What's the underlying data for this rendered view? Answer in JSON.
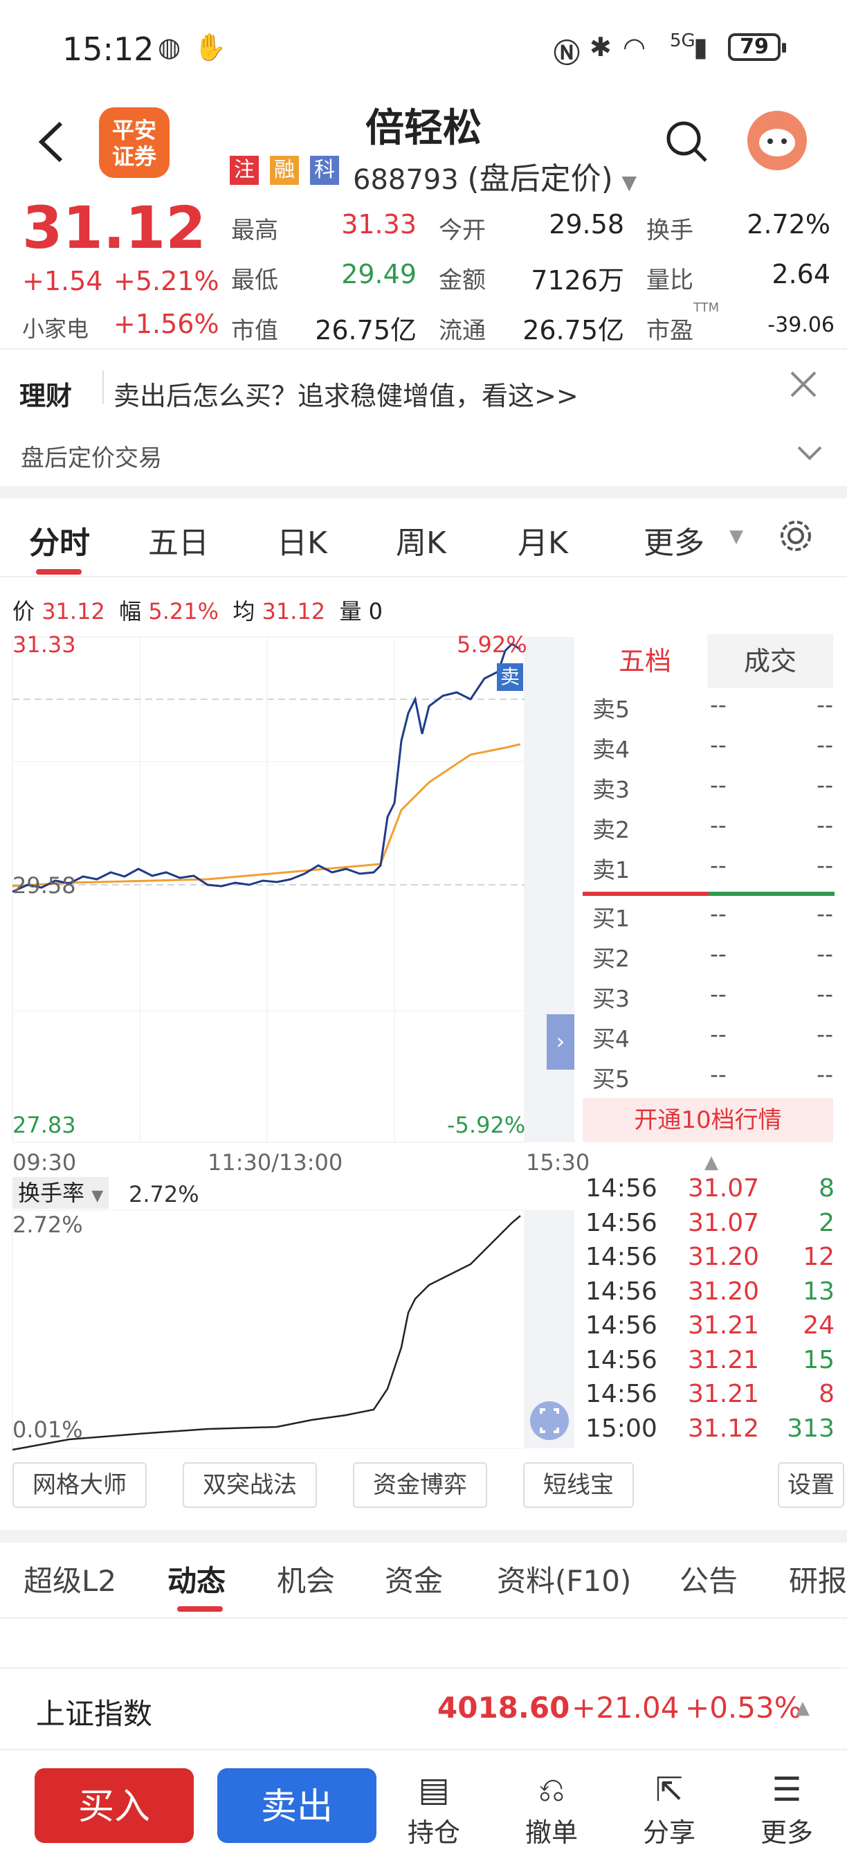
{
  "status": {
    "time": "15:12",
    "battery": "79",
    "net": "5G"
  },
  "header": {
    "logo_line1": "平安",
    "logo_line2": "证券",
    "stock_name": "倍轻松",
    "badges": [
      "注",
      "融",
      "科"
    ],
    "code": "688793",
    "mode": "(盘后定价)"
  },
  "quote": {
    "price": "31.12",
    "change": "+1.54",
    "change_pct": "+5.21%",
    "sector": "小家电",
    "sector_pct": "+1.56%",
    "stats": [
      {
        "label": "最高",
        "value": "31.33",
        "color": "red"
      },
      {
        "label": "今开",
        "value": "29.58",
        "color": "dark"
      },
      {
        "label": "换手",
        "value": "2.72%",
        "color": "dark"
      },
      {
        "label": "最低",
        "value": "29.49",
        "color": "green"
      },
      {
        "label": "金额",
        "value": "7126万",
        "color": "dark"
      },
      {
        "label": "量比",
        "value": "2.64",
        "color": "dark"
      },
      {
        "label": "市值",
        "value": "26.75亿",
        "color": "dark"
      },
      {
        "label": "流通",
        "value": "26.75亿",
        "color": "dark"
      },
      {
        "label": "市盈",
        "value": "-39.06",
        "color": "dark"
      }
    ],
    "pe_sup": "TTM"
  },
  "promo": {
    "tag": "理财",
    "text": "卖出后怎么买？追求稳健增值，看这>>"
  },
  "after_hours": "盘后定价交易",
  "ktabs": [
    "分时",
    "五日",
    "日K",
    "周K",
    "月K",
    "更多"
  ],
  "info_line": {
    "price_label": "价",
    "price": "31.12",
    "amp_label": "幅",
    "amp": "5.21%",
    "avg_label": "均",
    "avg": "31.12",
    "vol_label": "量",
    "vol": "0"
  },
  "chart_labels": {
    "high": "31.33",
    "high_pct": "5.92%",
    "mid": "29.58",
    "low": "27.83",
    "low_pct": "-5.92%",
    "t0": "09:30",
    "t1": "11:30/13:00",
    "t2": "15:30",
    "sell_tag": "卖"
  },
  "orderbook": {
    "tab1": "五档",
    "tab2": "成交",
    "asks": [
      "卖5",
      "卖4",
      "卖3",
      "卖2",
      "卖1"
    ],
    "bids": [
      "买1",
      "买2",
      "买3",
      "买4",
      "买5"
    ],
    "dash": "--",
    "open10": "开通10档行情"
  },
  "turnover": {
    "label": "换手率",
    "value": "2.72%",
    "max": "2.72%",
    "min": "0.01%"
  },
  "ticks": [
    {
      "t": "14:56",
      "p": "31.07",
      "v": "8",
      "c": "green"
    },
    {
      "t": "14:56",
      "p": "31.07",
      "v": "2",
      "c": "green"
    },
    {
      "t": "14:56",
      "p": "31.20",
      "v": "12",
      "c": "red"
    },
    {
      "t": "14:56",
      "p": "31.20",
      "v": "13",
      "c": "green"
    },
    {
      "t": "14:56",
      "p": "31.21",
      "v": "24",
      "c": "red"
    },
    {
      "t": "14:56",
      "p": "31.21",
      "v": "15",
      "c": "green"
    },
    {
      "t": "14:56",
      "p": "31.21",
      "v": "8",
      "c": "red"
    },
    {
      "t": "15:00",
      "p": "31.12",
      "v": "313",
      "c": "green"
    }
  ],
  "tools": [
    "网格大师",
    "双突战法",
    "资金博弈",
    "短线宝",
    "设置"
  ],
  "btabs": [
    "超级L2",
    "动态",
    "机会",
    "资金",
    "资料(F10)",
    "公告",
    "研报"
  ],
  "index": {
    "name": "上证指数",
    "value": "4018.60",
    "chg": "+21.04",
    "pct": "+0.53%"
  },
  "footer": {
    "buy": "买入",
    "sell": "卖出",
    "items": [
      "持仓",
      "撤单",
      "分享",
      "更多"
    ]
  },
  "colors": {
    "red": "#e0363c",
    "green": "#2f9a4f",
    "blue": "#2b6fe0",
    "price_line": "#1f3a8a",
    "avg_line": "#f0a030"
  }
}
